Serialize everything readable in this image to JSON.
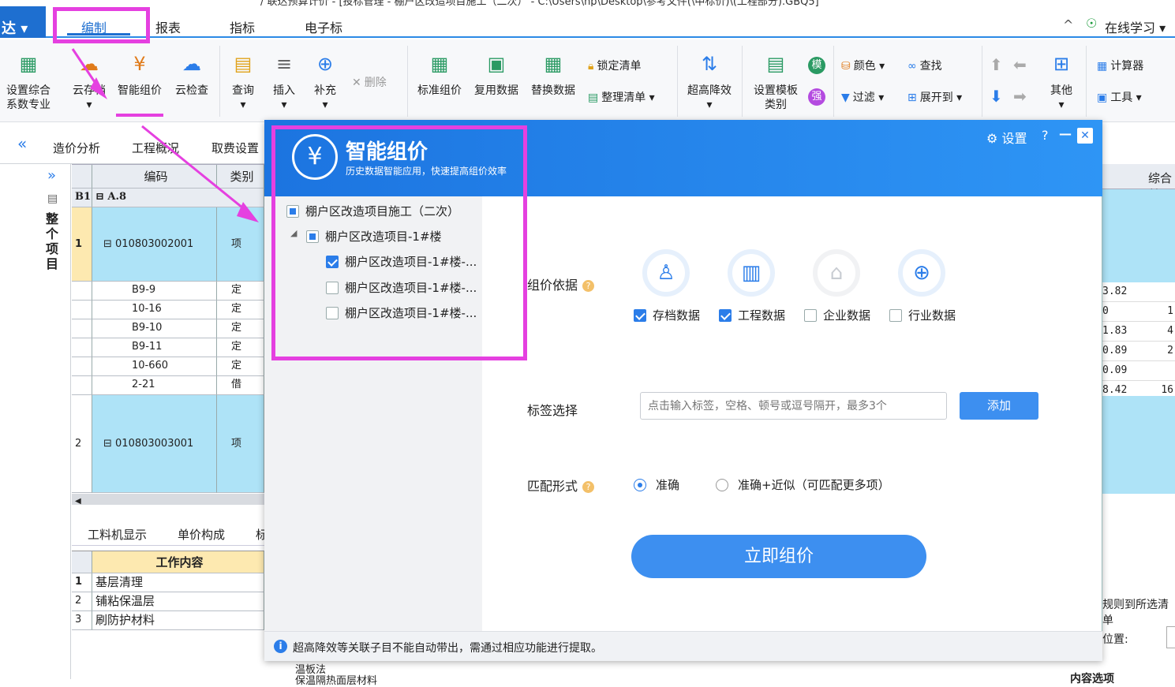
{
  "title_bar": {
    "text": "/ 联达预算计价 - [投标管理 - 棚户区改造项目施工（二次） - C:\\Users\\hp\\Desktop\\参考文件(\\中标价)\\(工程部分).GBQ5]"
  },
  "app_button": {
    "label": "达 ▾"
  },
  "menu": {
    "tabs": [
      "编制",
      "报表",
      "指标",
      "电子标"
    ],
    "right_caret": "^",
    "online_label": "在线学习 ▾"
  },
  "ribbon": {
    "b1": "设置综合\n系数专业",
    "b2": "云存档",
    "b3": "智能组价",
    "b4": "云检查",
    "b5": "查询",
    "b6": "插入",
    "b7": "补充",
    "delete": "删除",
    "b8": "标准组价",
    "b9": "复用数据",
    "b10": "替换数据",
    "lock": "锁定清单",
    "organize": "整理清单",
    "b11": "超高降效",
    "b12": "设置模板\n类别",
    "color": "颜色",
    "filter": "过滤",
    "find": "查找",
    "expand": "展开到",
    "other": "其他",
    "calculator": "计算器",
    "tools": "工具"
  },
  "sub_tabs": [
    "造价分析",
    "工程概况",
    "取费设置"
  ],
  "left_strip": {
    "label": "整个项目"
  },
  "grid": {
    "headers": {
      "code": "编码",
      "type": "类别"
    },
    "b1": {
      "num": "B1",
      "code": "A.8"
    },
    "rows": [
      {
        "num": "1",
        "code": "010803002001",
        "type": "项"
      },
      {
        "num": "",
        "code": "B9-9",
        "type": "定"
      },
      {
        "num": "",
        "code": "10-16",
        "type": "定"
      },
      {
        "num": "",
        "code": "B9-10",
        "type": "定"
      },
      {
        "num": "",
        "code": "B9-11",
        "type": "定"
      },
      {
        "num": "",
        "code": "10-660",
        "type": "定"
      },
      {
        "num": "",
        "code": "2-21",
        "type": "借"
      },
      {
        "num": "2",
        "code": "010803003001",
        "type": "项"
      }
    ]
  },
  "right_column": {
    "header": "综合单",
    "values": [
      "3.82",
      "0",
      "1.83",
      "0.89",
      "0.09",
      "8.42"
    ],
    "values2": [
      "",
      "1",
      "4",
      "2",
      "",
      "16"
    ]
  },
  "bottom": {
    "tabs": [
      "工料机显示",
      "单价构成",
      "标"
    ],
    "table_header": "工作内容",
    "rows": [
      {
        "n": "1",
        "t": "基层清理"
      },
      {
        "n": "2",
        "t": "铺粘保温层"
      },
      {
        "n": "3",
        "t": "刷防护材料"
      }
    ],
    "extra1": "温板法",
    "extra2": "保温隔热面层材料"
  },
  "right_side": {
    "text1": "规则到所选清单",
    "text2": "位置:",
    "text3": "内容选项"
  },
  "dialog": {
    "title": "智能组价",
    "subtitle": "历史数据智能应用，快速提高组价效率",
    "settings": "设置",
    "help": "?",
    "minimize": "—",
    "close": "✕",
    "tree": {
      "root": "棚户区改造项目施工（二次）",
      "child": "棚户区改造项目-1#楼",
      "leaves": [
        "棚户区改造项目-1#楼-...",
        "棚户区改造项目-1#楼-...",
        "棚户区改造项目-1#楼-..."
      ],
      "leaf_checked": [
        true,
        false,
        false
      ]
    },
    "basis_label": "组价依据",
    "sources": [
      {
        "label": "存档数据",
        "checked": true
      },
      {
        "label": "工程数据",
        "checked": true
      },
      {
        "label": "企业数据",
        "checked": false
      },
      {
        "label": "行业数据",
        "checked": false
      }
    ],
    "tag_label": "标签选择",
    "tag_placeholder": "点击输入标签，空格、顿号或逗号隔开，最多3个",
    "add_button": "添加",
    "match_label": "匹配形式",
    "match_options": [
      "准确",
      "准确+近似（可匹配更多项）"
    ],
    "match_selected": 0,
    "go_button": "立即组价",
    "footer": "超高降效等关联子目不能自动带出，需通过相应功能进行提取。"
  },
  "colors": {
    "accent": "#2b7de9",
    "highlight": "#e540e0",
    "row": "#aee3f7"
  }
}
